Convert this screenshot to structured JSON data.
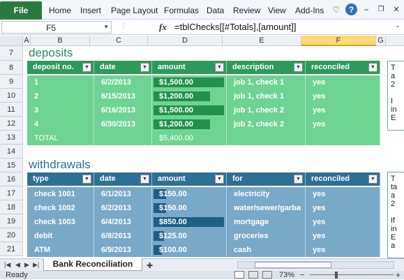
{
  "ribbon": {
    "file": "File",
    "tabs": [
      "Home",
      "Insert",
      "Page Layout",
      "Formulas",
      "Data",
      "Review",
      "View",
      "Add-Ins"
    ]
  },
  "formula_bar": {
    "name_box": "F5",
    "fx": "fx",
    "formula": "=tblChecks[[#Totals],[amount]]"
  },
  "columns": [
    "A",
    "B",
    "C",
    "D",
    "E",
    "F",
    "G"
  ],
  "selected_column": "F",
  "rows": [
    "7",
    "8",
    "9",
    "10",
    "11",
    "12",
    "13",
    "14",
    "15",
    "16",
    "17",
    "18",
    "19",
    "20",
    "21"
  ],
  "deposits": {
    "title": "deposits",
    "headers": [
      "deposit no.",
      "date",
      "amount",
      "description",
      "reconciled"
    ],
    "rows": [
      {
        "no": "1",
        "date": "6/2/2013",
        "amount": "$1,500.00",
        "amount_value": 1500,
        "desc": "job 1, check 1",
        "rec": "yes"
      },
      {
        "no": "2",
        "date": "6/15/2013",
        "amount": "$1,200.00",
        "amount_value": 1200,
        "desc": "job 1, check 1",
        "rec": "yes"
      },
      {
        "no": "3",
        "date": "6/16/2013",
        "amount": "$1,500.00",
        "amount_value": 1500,
        "desc": "job 1, check 2",
        "rec": "yes"
      },
      {
        "no": "4",
        "date": "6/30/2013",
        "amount": "$1,200.00",
        "amount_value": 1200,
        "desc": "job 2, check 2",
        "rec": "yes"
      }
    ],
    "total_label": "TOTAL",
    "total_amount": "$5,400.00",
    "side_note": "T\na\n2\n\nI\nin\nE"
  },
  "withdrawals": {
    "title": "withdrawals",
    "headers": [
      "type",
      "date",
      "amount",
      "for",
      "reconciled"
    ],
    "rows": [
      {
        "type": "check 1001",
        "date": "6/1/2013",
        "amount": "$150.00",
        "amount_value": 150,
        "for": "electricity",
        "rec": "yes"
      },
      {
        "type": "check 1002",
        "date": "6/2/2013",
        "amount": "$150.00",
        "amount_value": 150,
        "for": "water/sewer/garba",
        "rec": "yes"
      },
      {
        "type": "check 1003",
        "date": "6/4/2013",
        "amount": "$850.00",
        "amount_value": 850,
        "for": "mortgage",
        "rec": "yes"
      },
      {
        "type": "debit",
        "date": "6/8/2013",
        "amount": "$125.00",
        "amount_value": 125,
        "for": "groceries",
        "rec": "yes"
      },
      {
        "type": "ATM",
        "date": "6/9/2013",
        "amount": "$100.00",
        "amount_value": 100,
        "for": "cash",
        "rec": "yes"
      }
    ],
    "side_note": "T\nta\na\n2\n\nIf\nin\nE\na"
  },
  "sheet_tab": "Bank Reconciliation",
  "status": {
    "ready": "Ready",
    "zoom": "73%"
  },
  "colors": {
    "green_header": "#2e9a5a",
    "green_row": "#6fd393",
    "green_bar": "#22914a",
    "blue_header": "#2e6f94",
    "blue_row": "#78a9c9",
    "blue_bar": "#1f5f86"
  }
}
